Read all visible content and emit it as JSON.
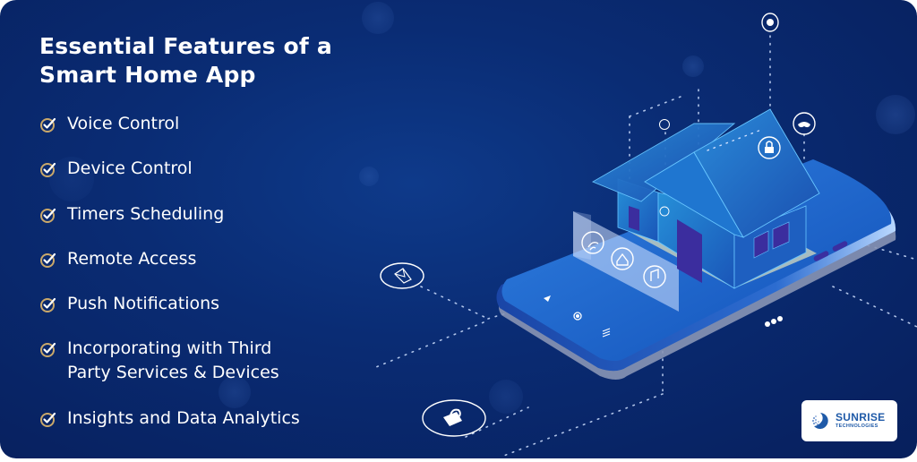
{
  "title": {
    "line1": "Essential Features of a",
    "line2": "Smart Home App"
  },
  "features": [
    {
      "lines": [
        "Voice Control"
      ]
    },
    {
      "lines": [
        "Device Control"
      ]
    },
    {
      "lines": [
        "Timers Scheduling"
      ]
    },
    {
      "lines": [
        "Remote Access"
      ]
    },
    {
      "lines": [
        "Push Notifications"
      ]
    },
    {
      "lines": [
        "Incorporating with Third",
        "Party Services & Devices"
      ]
    },
    {
      "lines": [
        "Insights and Data Analytics"
      ]
    }
  ],
  "illustration": {
    "floating_icons": [
      "brain-icon",
      "music-icon",
      "lock-icon",
      "gamepad-icon",
      "envelope-icon",
      "padlock-icon"
    ],
    "panel_icons": [
      "wifi-icon",
      "home-icon",
      "music-note-icon"
    ],
    "phone_nav_icons": [
      "back-icon",
      "home-button-icon",
      "menu-icon"
    ]
  },
  "logo": {
    "name": "SUNRISE",
    "subtitle": "TECHNOLOGIES"
  },
  "colors": {
    "background": "#0a2c74",
    "accent_gold": "#c9a86a",
    "text": "#ffffff",
    "logo_blue": "#1f5aa8"
  }
}
